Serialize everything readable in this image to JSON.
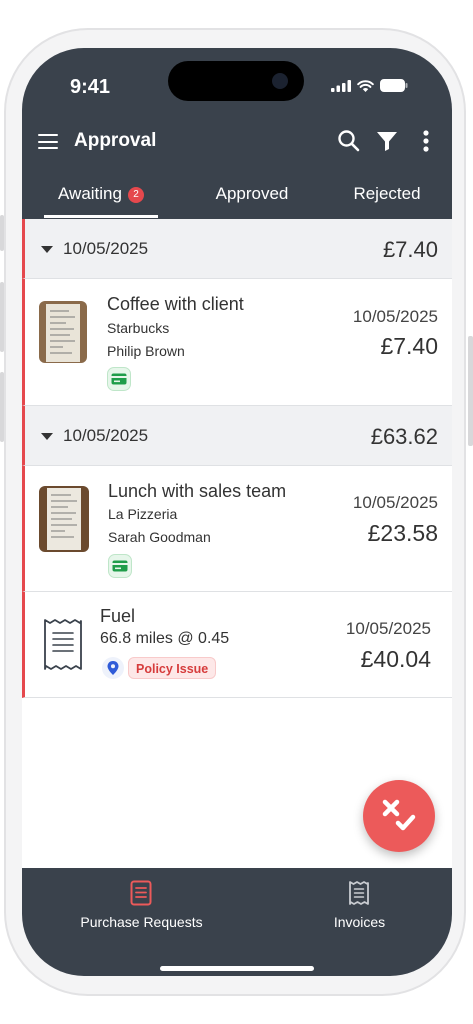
{
  "status_bar": {
    "time": "9:41"
  },
  "header": {
    "title": "Approval"
  },
  "toolbar_icons": [
    "menu-icon",
    "search-icon",
    "filter-icon",
    "more-vert-icon"
  ],
  "tabs": [
    {
      "label": "Awaiting",
      "badge": "2",
      "active": true
    },
    {
      "label": "Approved",
      "active": false
    },
    {
      "label": "Rejected",
      "active": false
    }
  ],
  "groups": [
    {
      "date": "10/05/2025",
      "total": "£7.40",
      "items": [
        {
          "title": "Coffee with client",
          "line1": "Starbucks",
          "line2": "Philip Brown",
          "date": "10/05/2025",
          "amount": "£7.40",
          "chip": "credit-card-icon"
        }
      ]
    },
    {
      "date": "10/05/2025",
      "total": "£63.62",
      "items": [
        {
          "title": "Lunch with sales team",
          "line1": "La Pizzeria",
          "line2": "Sarah Goodman",
          "date": "10/05/2025",
          "amount": "£23.58",
          "chip": "credit-card-icon"
        },
        {
          "title": "Fuel",
          "line1": "66.8 miles @ 0.45",
          "date": "10/05/2025",
          "amount": "£40.04",
          "chip": "location-pin-icon",
          "tag": "Policy Issue"
        }
      ]
    }
  ],
  "bottom_nav": [
    {
      "label": "Purchase Requests",
      "icon": "document-list-icon",
      "active": true
    },
    {
      "label": "Invoices",
      "icon": "invoice-icon",
      "active": false
    }
  ],
  "colors": {
    "header_bg": "#3a424c",
    "accent_red": "#e5484d",
    "fab_red": "#ec5a5a",
    "card_green": "#1f9d4a"
  }
}
